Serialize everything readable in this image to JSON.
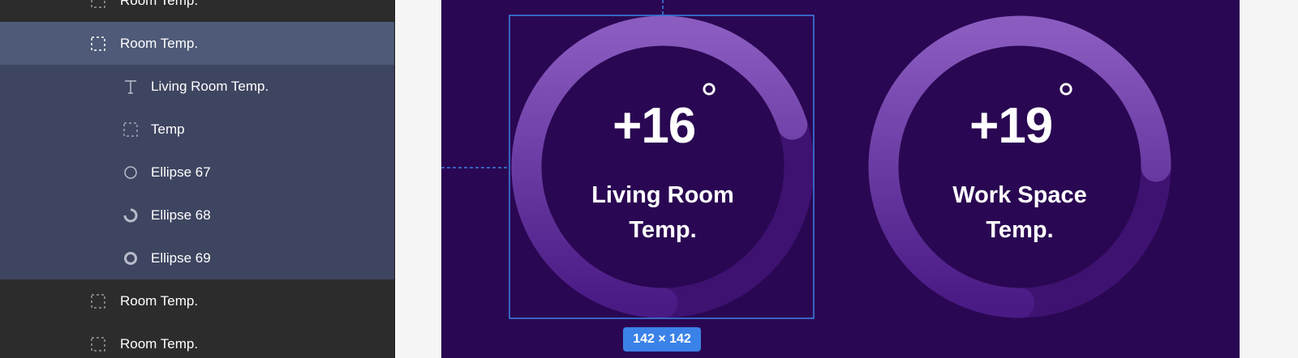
{
  "layers": {
    "items": [
      {
        "label": "Room Temp.",
        "icon": "frame-icon",
        "level": 0,
        "state": "normal"
      },
      {
        "label": "Room Temp.",
        "icon": "frame-icon",
        "level": 0,
        "state": "selected"
      },
      {
        "label": "Living Room Temp.",
        "icon": "text-icon",
        "level": 1,
        "state": "child"
      },
      {
        "label": "Temp",
        "icon": "frame-icon",
        "level": 1,
        "state": "child"
      },
      {
        "label": "Ellipse 67",
        "icon": "ellipse-icon",
        "level": 1,
        "state": "child"
      },
      {
        "label": "Ellipse 68",
        "icon": "arc-icon",
        "level": 1,
        "state": "child"
      },
      {
        "label": "Ellipse 69",
        "icon": "ring-icon",
        "level": 1,
        "state": "child"
      },
      {
        "label": "Room Temp.",
        "icon": "frame-icon",
        "level": 0,
        "state": "normal"
      },
      {
        "label": "Room Temp.",
        "icon": "frame-icon",
        "level": 0,
        "state": "normal"
      }
    ]
  },
  "canvas": {
    "selection_size": "142 × 142",
    "widgets": [
      {
        "temp": "+16",
        "degree": "°",
        "label_line1": "Living Room",
        "label_line2": "Temp.",
        "progress": 0.7
      },
      {
        "temp": "+19",
        "degree": "°",
        "label_line1": "Work Space",
        "label_line2": "Temp.",
        "progress": 0.75
      }
    ]
  },
  "colors": {
    "panel_bg": "#2c2c2c",
    "selected_row": "#4e5a78",
    "child_row": "#3e4560",
    "frame_bg": "#2a0752",
    "ring_track": "#45167a",
    "ring_fill": "#8a5cc0",
    "selection": "#3b82e8"
  }
}
